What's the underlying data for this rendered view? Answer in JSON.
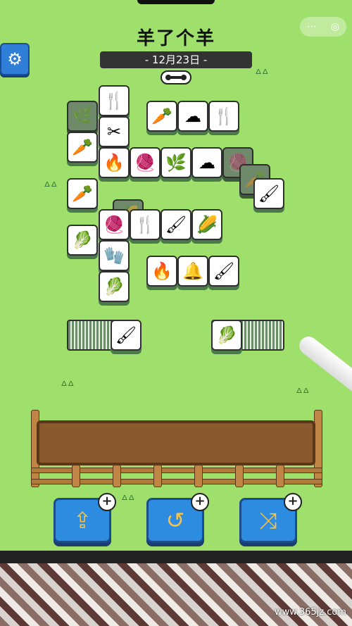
{
  "game": {
    "title": "羊了个羊",
    "date": "- 12月23日 -"
  },
  "capsule": {
    "menu_icon": "⋯",
    "close_icon": "◎"
  },
  "settings": {
    "icon": "⚙"
  },
  "board_tiles": [
    {
      "glyph": "🌿",
      "state": "dim"
    },
    {
      "glyph": "🍴",
      "state": "open"
    },
    {
      "glyph": "🌿",
      "state": "dim"
    },
    {
      "glyph": "🥕",
      "state": "open"
    },
    {
      "glyph": "☁",
      "state": "open"
    },
    {
      "glyph": "🍴",
      "state": "open"
    },
    {
      "glyph": "✂",
      "state": "open"
    },
    {
      "glyph": "🥕",
      "state": "open"
    },
    {
      "glyph": "🔥",
      "state": "open"
    },
    {
      "glyph": "🧶",
      "state": "open"
    },
    {
      "glyph": "🌿",
      "state": "open"
    },
    {
      "glyph": "☁",
      "state": "open"
    },
    {
      "glyph": "🧶",
      "state": "dim"
    },
    {
      "glyph": "🥕",
      "state": "dim"
    },
    {
      "glyph": "🖌",
      "state": "open"
    },
    {
      "glyph": "🥕",
      "state": "open"
    },
    {
      "glyph": "🌽",
      "state": "dim"
    },
    {
      "glyph": "🧶",
      "state": "open"
    },
    {
      "glyph": "🍴",
      "state": "open"
    },
    {
      "glyph": "🖌",
      "state": "open"
    },
    {
      "glyph": "🌽",
      "state": "open"
    },
    {
      "glyph": "🥬",
      "state": "open"
    },
    {
      "glyph": "🧤",
      "state": "open"
    },
    {
      "glyph": "🔥",
      "state": "open"
    },
    {
      "glyph": "🔔",
      "state": "open"
    },
    {
      "glyph": "🖌",
      "state": "open"
    },
    {
      "glyph": "🥬",
      "state": "open"
    }
  ],
  "left_stack": {
    "top_glyph": "🖌"
  },
  "right_stack": {
    "top_glyph": "🥬"
  },
  "actions": [
    {
      "name": "move-out",
      "icon": "⇪",
      "badge": "+"
    },
    {
      "name": "undo",
      "icon": "↺",
      "badge": "+"
    },
    {
      "name": "shuffle",
      "icon": "⤨",
      "badge": "+"
    }
  ],
  "watermark": "www.365jz.com"
}
